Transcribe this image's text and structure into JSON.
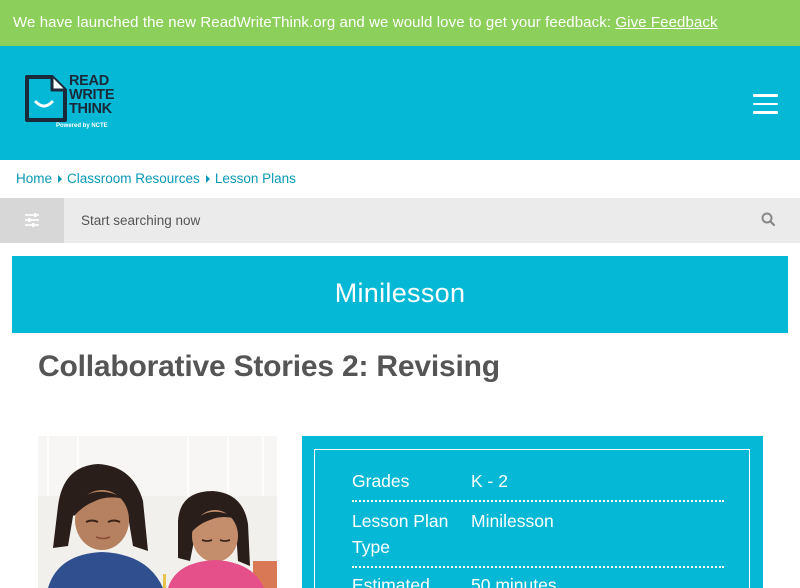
{
  "banner": {
    "text": "We have launched the new ReadWriteThink.org and we would love to get your feedback: ",
    "link": "Give Feedback"
  },
  "logo": {
    "line1": "READ",
    "line2": "WRITE",
    "line3": "THINK",
    "powered": "Powered by NCTE"
  },
  "breadcrumb": [
    "Home",
    "Classroom Resources",
    "Lesson Plans"
  ],
  "search": {
    "placeholder": "Start searching now"
  },
  "resource_type": "Minilesson",
  "title": "Collaborative Stories 2: Revising",
  "details": [
    {
      "label": "Grades",
      "value": "K - 2"
    },
    {
      "label": "Lesson Plan Type",
      "value": "Minilesson"
    },
    {
      "label": "Estimated",
      "value": "50 minutes"
    }
  ],
  "colors": {
    "banner": "#8cd05b",
    "brand": "#05b8d6",
    "link": "#0a99b5",
    "title": "#555555"
  }
}
